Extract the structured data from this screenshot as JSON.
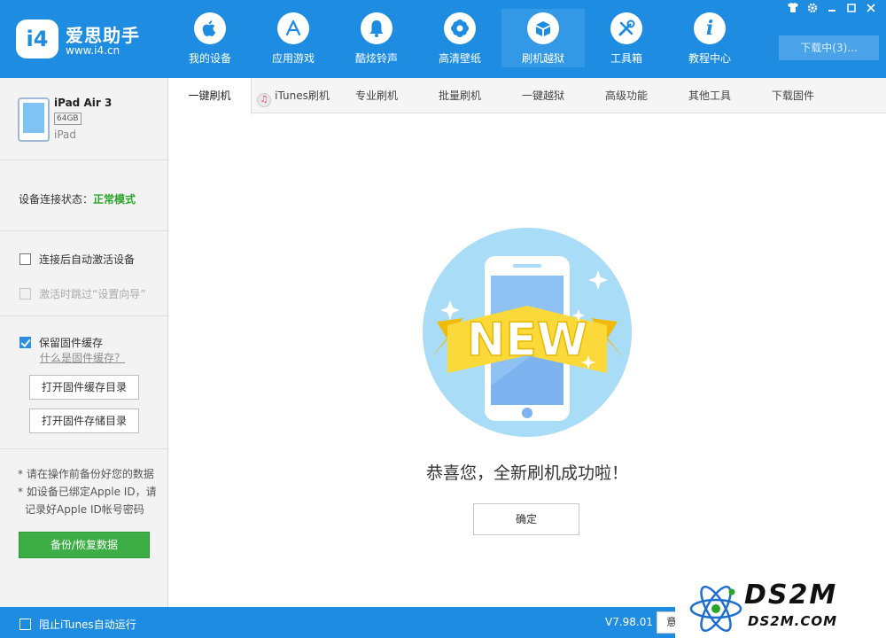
{
  "app": {
    "logo_mark": "i4",
    "name": "爱思助手",
    "url": "www.i4.cn"
  },
  "nav": [
    {
      "label": "我的设备",
      "icon": "apple-icon",
      "glyph": ""
    },
    {
      "label": "应用游戏",
      "icon": "app-store-icon",
      "glyph": "A"
    },
    {
      "label": "酷炫铃声",
      "icon": "bell-icon",
      "glyph": "♪"
    },
    {
      "label": "高清壁纸",
      "icon": "flower-icon",
      "glyph": "✿"
    },
    {
      "label": "刷机越狱",
      "icon": "box-icon",
      "glyph": "❒"
    },
    {
      "label": "工具箱",
      "icon": "tools-icon",
      "glyph": "✕"
    },
    {
      "label": "教程中心",
      "icon": "info-icon",
      "glyph": "i"
    }
  ],
  "active_nav": 4,
  "window_controls": [
    "shirt-icon",
    "gear-icon",
    "minimize-icon",
    "maximize-icon",
    "close-icon"
  ],
  "download": {
    "label": "下载中(3)..."
  },
  "device": {
    "name": "iPad Air 3",
    "capacity": "64GB",
    "type": "iPad"
  },
  "connection": {
    "label": "设备连接状态：",
    "status": "正常模式",
    "status_color": "#2aa52a"
  },
  "options": {
    "auto_activate": "连接后自动激活设备",
    "skip_setup": "激活时跳过“设置向导”"
  },
  "firmware": {
    "keep_cache": "保留固件缓存",
    "what_is": "什么是固件缓存？",
    "open_cache_dir": "打开固件缓存目录",
    "open_storage_dir": "打开固件存储目录"
  },
  "notes": {
    "line1": "* 请在操作前备份好您的数据",
    "line2": "* 如设备已绑定Apple ID，请",
    "line3": "记录好Apple ID帐号密码"
  },
  "backup_button": "备份/恢复数据",
  "tabs": [
    "一键刷机",
    "iTunes刷机",
    "专业刷机",
    "批量刷机",
    "一键越狱",
    "高级功能",
    "其他工具",
    "下载固件"
  ],
  "active_tab": 0,
  "illustration": {
    "banner_text": "NEW"
  },
  "success_message": "恭喜您，全新刷机成功啦！",
  "confirm_button": "确定",
  "footer": {
    "block_itunes": "阻止iTunes自动运行",
    "version": "V7.98.01",
    "feedback_button": "意"
  },
  "watermark": {
    "title": "DS2M",
    "url": "DS2M.COM"
  },
  "colors": {
    "primary": "#1e8ce0",
    "success": "#3cae45"
  }
}
